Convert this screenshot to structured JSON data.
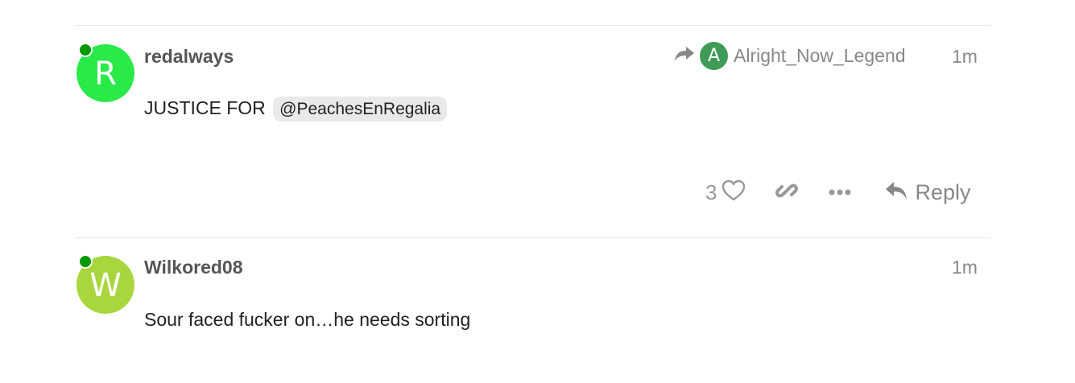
{
  "posts": [
    {
      "avatar_letter": "R",
      "avatar_color": "#2aea4a",
      "username": "redalways",
      "reply_to": {
        "avatar_letter": "A",
        "avatar_color": "#3f9b58",
        "username": "Alright_Now_Legend"
      },
      "time": "1m",
      "body_text": "JUSTICE FOR",
      "mention": "@PeachesEnRegalia",
      "likes": "3",
      "reply_label": "Reply"
    },
    {
      "avatar_letter": "W",
      "avatar_color": "#a8d63c",
      "username": "Wilkored08",
      "time": "1m",
      "body_text": "Sour faced fucker on…he needs sorting"
    }
  ],
  "icons": {
    "share": "share-arrow-icon",
    "like": "heart-icon",
    "link": "link-icon",
    "more": "ellipsis-icon",
    "reply": "reply-icon"
  },
  "colors": {
    "online": "#009900",
    "muted_text": "#888888",
    "divider": "#e9e9e9"
  }
}
